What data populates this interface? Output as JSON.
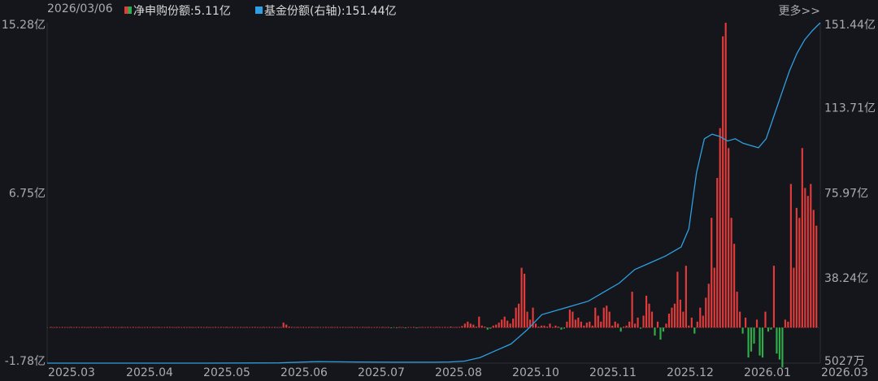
{
  "header": {
    "date": "2026/03/06",
    "more_label": "更多>>"
  },
  "legend": [
    {
      "label": "净申购份额:5.11亿",
      "color": "#e23b3b",
      "color2": "#2eae4b"
    },
    {
      "label": "基金份额(右轴):151.44亿",
      "color": "#2e9fe0"
    }
  ],
  "colors": {
    "positive_bar": "#e23b3b",
    "negative_bar": "#2eae4b",
    "line": "#2e9fe0",
    "background": "#15161b"
  },
  "chart_data": {
    "type": "bar+line",
    "left_axis": {
      "ticks": [
        "15.28亿",
        "6.75亿",
        "-1.78亿"
      ],
      "values": [
        15.28,
        6.75,
        -1.78
      ],
      "unit": "亿"
    },
    "right_axis": {
      "ticks": [
        "151.44亿",
        "113.71亿",
        "75.97亿",
        "38.24亿",
        "5027万"
      ],
      "values": [
        151.44,
        113.71,
        75.97,
        38.24,
        0.5027
      ],
      "unit": "亿"
    },
    "x_ticks": [
      "2025.03",
      "2025.04",
      "2025.05",
      "2025.06",
      "2025.07",
      "2025.08",
      "2025.10",
      "2025.11",
      "2025.12",
      "2026.01",
      "2026.03"
    ],
    "series": [
      {
        "name": "净申购份额",
        "axis": "left",
        "type": "bar",
        "values": [
          0.02,
          0,
          0.01,
          0,
          0.02,
          0,
          0,
          0.01,
          0,
          0.02,
          0,
          0.01,
          0,
          0,
          0.02,
          0,
          0.01,
          0,
          0,
          0.01,
          0.02,
          0,
          0.01,
          0,
          0,
          0.02,
          0,
          0.01,
          0,
          0.01,
          0,
          0.02,
          0,
          0,
          0.01,
          0,
          0.02,
          0,
          0.01,
          0,
          0,
          0.01,
          0.02,
          0,
          0,
          0.01,
          0,
          0.02,
          0,
          0.01,
          0,
          0,
          0.01,
          0.02,
          0,
          0.01,
          0,
          0,
          0.02,
          0,
          0.01,
          0,
          0.02,
          0,
          0.01,
          0,
          0,
          0.02,
          0,
          0.01,
          0,
          0.01,
          0.02,
          0,
          0,
          0.01,
          0,
          0.02,
          0,
          0.01,
          0,
          0,
          0.25,
          0.15,
          0.05,
          0.02,
          0,
          0.01,
          0,
          0.02,
          0,
          0.01,
          0.02,
          0,
          0.01,
          0,
          0,
          0.02,
          0,
          0.01,
          0,
          0.02,
          0,
          0.01,
          0,
          0,
          0.02,
          0,
          0.01,
          0,
          0.02,
          0,
          0.01,
          0,
          0,
          0.02,
          0,
          0.01,
          0,
          0.01,
          -0.01,
          0,
          -0.02,
          0.01,
          0,
          -0.02,
          0,
          0,
          0.01,
          -0.01,
          0,
          0.02,
          0,
          0.01,
          0.02,
          0,
          0.01,
          0.02,
          0,
          0.03,
          0,
          0.05,
          0,
          0.02,
          0.02,
          0.08,
          0.2,
          0.3,
          0.2,
          0.15,
          0.05,
          0.55,
          0.1,
          0.05,
          -0.1,
          -0.05,
          0.1,
          0.15,
          0.25,
          0.4,
          0.55,
          0.35,
          0.2,
          0.45,
          1.0,
          1.2,
          3.0,
          2.7,
          0.8,
          0.4,
          1.0,
          0.2,
          0.05,
          0.1,
          0.1,
          0.05,
          0.2,
          0.02,
          0.1,
          0.05,
          -0.1,
          -0.05,
          0.3,
          0.9,
          0.8,
          0.4,
          0.5,
          0.3,
          0.1,
          0.25,
          0.3,
          0.1,
          1.0,
          0.6,
          0.3,
          1.0,
          1.1,
          0.8,
          0.1,
          0.3,
          0.2,
          -0.2,
          0.05,
          0.1,
          0.3,
          1.8,
          0.2,
          0.5,
          -0.05,
          0.6,
          1.6,
          1.2,
          0.8,
          -0.4,
          0.3,
          -0.6,
          -0.2,
          0.2,
          0.7,
          1.0,
          1.2,
          2.8,
          1.4,
          0.8,
          3.1,
          0.1,
          0.5,
          -0.3,
          0.3,
          1.0,
          0.6,
          1.5,
          2.2,
          5.5,
          3.0,
          7.5,
          10.0,
          14.6,
          15.28,
          9.0,
          5.5,
          4.2,
          1.8,
          0.8,
          -0.3,
          0.5,
          -1.5,
          -1.2,
          -0.8,
          0.4,
          -1.4,
          -1.5,
          0.8,
          -0.2,
          -0.1,
          3.1,
          -1.3,
          -1.6,
          -2.0,
          0.4,
          0.3,
          7.2,
          3.0,
          6.0,
          5.5,
          9.0,
          7.0,
          6.6,
          7.2,
          5.9,
          5.11
        ]
      },
      {
        "name": "基金份额(右轴)",
        "axis": "right",
        "type": "line",
        "x": [
          0,
          0.1,
          0.2,
          0.3,
          0.35,
          0.4,
          0.45,
          0.5,
          0.52,
          0.54,
          0.56,
          0.58,
          0.6,
          0.62,
          0.64,
          0.66,
          0.68,
          0.7,
          0.72,
          0.74,
          0.76,
          0.78,
          0.8,
          0.81,
          0.82,
          0.83,
          0.84,
          0.85,
          0.86,
          0.87,
          0.88,
          0.89,
          0.9,
          0.91,
          0.92,
          0.93,
          0.94,
          0.95,
          0.96,
          0.97,
          0.98,
          0.99,
          1.0
        ],
        "y": [
          0.5,
          0.5,
          0.5,
          0.6,
          1.2,
          1.0,
          0.9,
          0.9,
          1.0,
          1.4,
          3.0,
          6.0,
          9.0,
          15.0,
          22.0,
          24.0,
          26.0,
          28.0,
          32.0,
          36.0,
          42.0,
          45.0,
          48.0,
          50.0,
          52.0,
          60.0,
          85.0,
          100.0,
          102.0,
          101.0,
          99.0,
          100.0,
          98.0,
          97.0,
          96.0,
          100.0,
          110.0,
          120.0,
          130.0,
          138.0,
          144.0,
          148.0,
          151.44
        ]
      }
    ],
    "grid": false,
    "legend_position": "top-left"
  }
}
